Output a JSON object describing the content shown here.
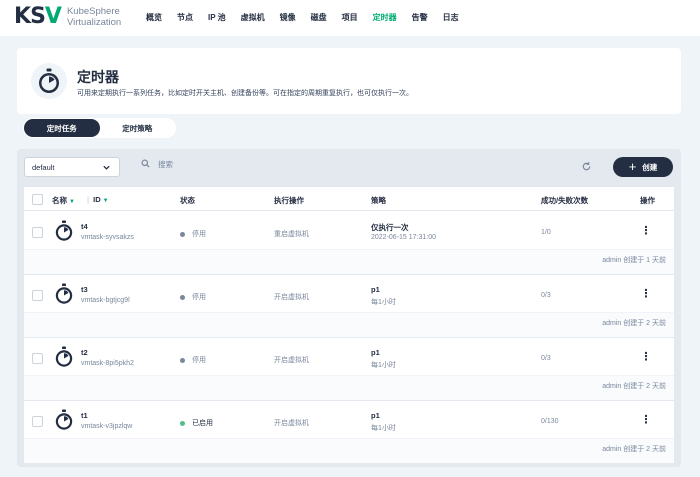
{
  "brand": {
    "mark_k": "K",
    "mark_s": "S",
    "mark_v": "V",
    "line1": "KubeSphere",
    "line2": "Virtualization"
  },
  "nav": [
    "概览",
    "节点",
    "IP 池",
    "虚拟机",
    "镜像",
    "磁盘",
    "项目",
    "定时器",
    "告警",
    "日志"
  ],
  "nav_active": "定时器",
  "header": {
    "title": "定时器",
    "description": "可用来定期执行一系列任务，比如定时开关主机、创建备份等。可在指定的周期重复执行，也可仅执行一次。"
  },
  "tabs": {
    "tasks": "定时任务",
    "policies": "定时策略"
  },
  "toolbar": {
    "project": "default",
    "search_placeholder": "搜索",
    "create": "创建"
  },
  "columns": {
    "name": "名称",
    "id": "ID",
    "status": "状态",
    "action": "执行操作",
    "policy": "策略",
    "count": "成功/失败次数",
    "ops": "操作"
  },
  "rows": [
    {
      "name": "t4",
      "id": "vmtask-syvsakzs",
      "status": "停用",
      "enabled": false,
      "action": "重启虚拟机",
      "policy": "仅执行一次",
      "policy_detail": "2022-06-15 17:31:00",
      "count": "1/0",
      "footnote": "admin 创建于 1 天前"
    },
    {
      "name": "t3",
      "id": "vmtask-bgtjcg9l",
      "status": "停用",
      "enabled": false,
      "action": "开启虚拟机",
      "policy": "p1",
      "policy_detail": "每1小时",
      "count": "0/3",
      "footnote": "admin 创建于 2 天前"
    },
    {
      "name": "t2",
      "id": "vmtask-8pi5pkh2",
      "status": "停用",
      "enabled": false,
      "action": "开启虚拟机",
      "policy": "p1",
      "policy_detail": "每1小时",
      "count": "0/3",
      "footnote": "admin 创建于 2 天前"
    },
    {
      "name": "t1",
      "id": "vmtask-v3jpzlqw",
      "status": "已启用",
      "enabled": true,
      "action": "开启虚拟机",
      "policy": "p1",
      "policy_detail": "每1小时",
      "count": "0/130",
      "footnote": "admin 创建于 2 天前"
    }
  ],
  "colors": {
    "accent": "#00aa72",
    "dark": "#242e42",
    "muted": "#79879c",
    "enabled_dot": "#55bc8a"
  }
}
